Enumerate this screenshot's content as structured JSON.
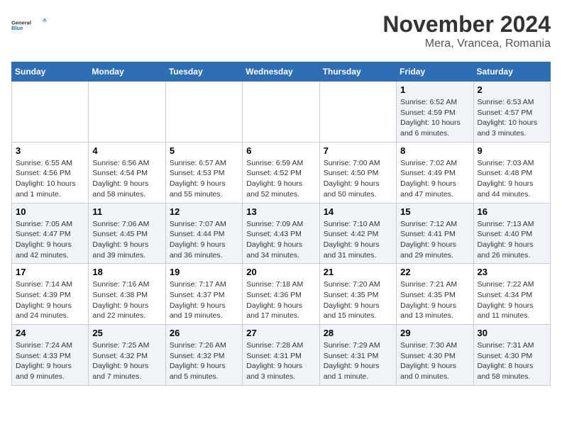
{
  "logo": {
    "general": "General",
    "blue": "Blue"
  },
  "title": "November 2024",
  "subtitle": "Mera, Vrancea, Romania",
  "weekdays": [
    "Sunday",
    "Monday",
    "Tuesday",
    "Wednesday",
    "Thursday",
    "Friday",
    "Saturday"
  ],
  "weeks": [
    [
      {
        "day": "",
        "info": ""
      },
      {
        "day": "",
        "info": ""
      },
      {
        "day": "",
        "info": ""
      },
      {
        "day": "",
        "info": ""
      },
      {
        "day": "",
        "info": ""
      },
      {
        "day": "1",
        "info": "Sunrise: 6:52 AM\nSunset: 4:59 PM\nDaylight: 10 hours and 6 minutes."
      },
      {
        "day": "2",
        "info": "Sunrise: 6:53 AM\nSunset: 4:57 PM\nDaylight: 10 hours and 3 minutes."
      }
    ],
    [
      {
        "day": "3",
        "info": "Sunrise: 6:55 AM\nSunset: 4:56 PM\nDaylight: 10 hours and 1 minute."
      },
      {
        "day": "4",
        "info": "Sunrise: 6:56 AM\nSunset: 4:54 PM\nDaylight: 9 hours and 58 minutes."
      },
      {
        "day": "5",
        "info": "Sunrise: 6:57 AM\nSunset: 4:53 PM\nDaylight: 9 hours and 55 minutes."
      },
      {
        "day": "6",
        "info": "Sunrise: 6:59 AM\nSunset: 4:52 PM\nDaylight: 9 hours and 52 minutes."
      },
      {
        "day": "7",
        "info": "Sunrise: 7:00 AM\nSunset: 4:50 PM\nDaylight: 9 hours and 50 minutes."
      },
      {
        "day": "8",
        "info": "Sunrise: 7:02 AM\nSunset: 4:49 PM\nDaylight: 9 hours and 47 minutes."
      },
      {
        "day": "9",
        "info": "Sunrise: 7:03 AM\nSunset: 4:48 PM\nDaylight: 9 hours and 44 minutes."
      }
    ],
    [
      {
        "day": "10",
        "info": "Sunrise: 7:05 AM\nSunset: 4:47 PM\nDaylight: 9 hours and 42 minutes."
      },
      {
        "day": "11",
        "info": "Sunrise: 7:06 AM\nSunset: 4:45 PM\nDaylight: 9 hours and 39 minutes."
      },
      {
        "day": "12",
        "info": "Sunrise: 7:07 AM\nSunset: 4:44 PM\nDaylight: 9 hours and 36 minutes."
      },
      {
        "day": "13",
        "info": "Sunrise: 7:09 AM\nSunset: 4:43 PM\nDaylight: 9 hours and 34 minutes."
      },
      {
        "day": "14",
        "info": "Sunrise: 7:10 AM\nSunset: 4:42 PM\nDaylight: 9 hours and 31 minutes."
      },
      {
        "day": "15",
        "info": "Sunrise: 7:12 AM\nSunset: 4:41 PM\nDaylight: 9 hours and 29 minutes."
      },
      {
        "day": "16",
        "info": "Sunrise: 7:13 AM\nSunset: 4:40 PM\nDaylight: 9 hours and 26 minutes."
      }
    ],
    [
      {
        "day": "17",
        "info": "Sunrise: 7:14 AM\nSunset: 4:39 PM\nDaylight: 9 hours and 24 minutes."
      },
      {
        "day": "18",
        "info": "Sunrise: 7:16 AM\nSunset: 4:38 PM\nDaylight: 9 hours and 22 minutes."
      },
      {
        "day": "19",
        "info": "Sunrise: 7:17 AM\nSunset: 4:37 PM\nDaylight: 9 hours and 19 minutes."
      },
      {
        "day": "20",
        "info": "Sunrise: 7:18 AM\nSunset: 4:36 PM\nDaylight: 9 hours and 17 minutes."
      },
      {
        "day": "21",
        "info": "Sunrise: 7:20 AM\nSunset: 4:35 PM\nDaylight: 9 hours and 15 minutes."
      },
      {
        "day": "22",
        "info": "Sunrise: 7:21 AM\nSunset: 4:35 PM\nDaylight: 9 hours and 13 minutes."
      },
      {
        "day": "23",
        "info": "Sunrise: 7:22 AM\nSunset: 4:34 PM\nDaylight: 9 hours and 11 minutes."
      }
    ],
    [
      {
        "day": "24",
        "info": "Sunrise: 7:24 AM\nSunset: 4:33 PM\nDaylight: 9 hours and 9 minutes."
      },
      {
        "day": "25",
        "info": "Sunrise: 7:25 AM\nSunset: 4:32 PM\nDaylight: 9 hours and 7 minutes."
      },
      {
        "day": "26",
        "info": "Sunrise: 7:26 AM\nSunset: 4:32 PM\nDaylight: 9 hours and 5 minutes."
      },
      {
        "day": "27",
        "info": "Sunrise: 7:28 AM\nSunset: 4:31 PM\nDaylight: 9 hours and 3 minutes."
      },
      {
        "day": "28",
        "info": "Sunrise: 7:29 AM\nSunset: 4:31 PM\nDaylight: 9 hours and 1 minute."
      },
      {
        "day": "29",
        "info": "Sunrise: 7:30 AM\nSunset: 4:30 PM\nDaylight: 9 hours and 0 minutes."
      },
      {
        "day": "30",
        "info": "Sunrise: 7:31 AM\nSunset: 4:30 PM\nDaylight: 8 hours and 58 minutes."
      }
    ]
  ]
}
